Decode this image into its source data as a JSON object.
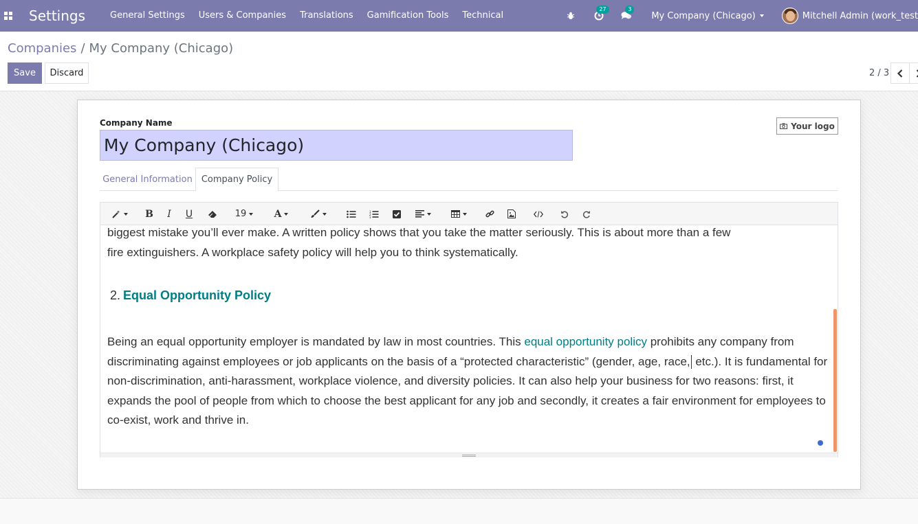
{
  "navbar": {
    "app_title": "Settings",
    "menu": [
      "General Settings",
      "Users & Companies",
      "Translations",
      "Gamification Tools",
      "Technical"
    ],
    "activity_count": "27",
    "messages_count": "3",
    "company": "My Company (Chicago)",
    "user": "Mitchell Admin (work_test"
  },
  "breadcrumb": {
    "parent": "Companies",
    "separator": "/",
    "current": "My Company (Chicago)"
  },
  "buttons": {
    "save": "Save",
    "discard": "Discard"
  },
  "pager": {
    "value": "2 / 3"
  },
  "form": {
    "company_name_label": "Company Name",
    "company_name": "My Company (Chicago)",
    "logo_button": "Your logo",
    "tabs": [
      "General Information",
      "Company Policy"
    ],
    "active_tab": "Company Policy"
  },
  "editor": {
    "font_size": "19",
    "para1_line1": "biggest mistake you’ll ever make. A written policy shows that you take the matter seriously. This is about more than a few",
    "para1_line2": "fire extinguishers. A workplace safety policy will help you to think systematically.",
    "heading_number": "2.",
    "heading_text": "Equal Opportunity Policy",
    "para2_a": "Being an equal opportunity employer is mandated by law in most countries. This ",
    "para2_link": "equal opportunity policy",
    "para2_b": " prohibits any company from discriminating against employees or job applicants on the basis of a “protected characteristic” (gender, age, race,",
    "para2_c": " etc.). It is fundamental for non-discrimination, anti-harassment, workplace violence, and diversity policies. It can also help your business for two reasons: first, it expands the pool of people from which to choose the best applicant for any job and secondly, it creates a fair environment for employees to co-exist, work and thrive in."
  },
  "colors": {
    "brand": "#7c7bad",
    "link": "#017e84",
    "badge": "#00a09d",
    "scrollbar": "#f0956b",
    "input_bg": "#d2d2ff"
  }
}
